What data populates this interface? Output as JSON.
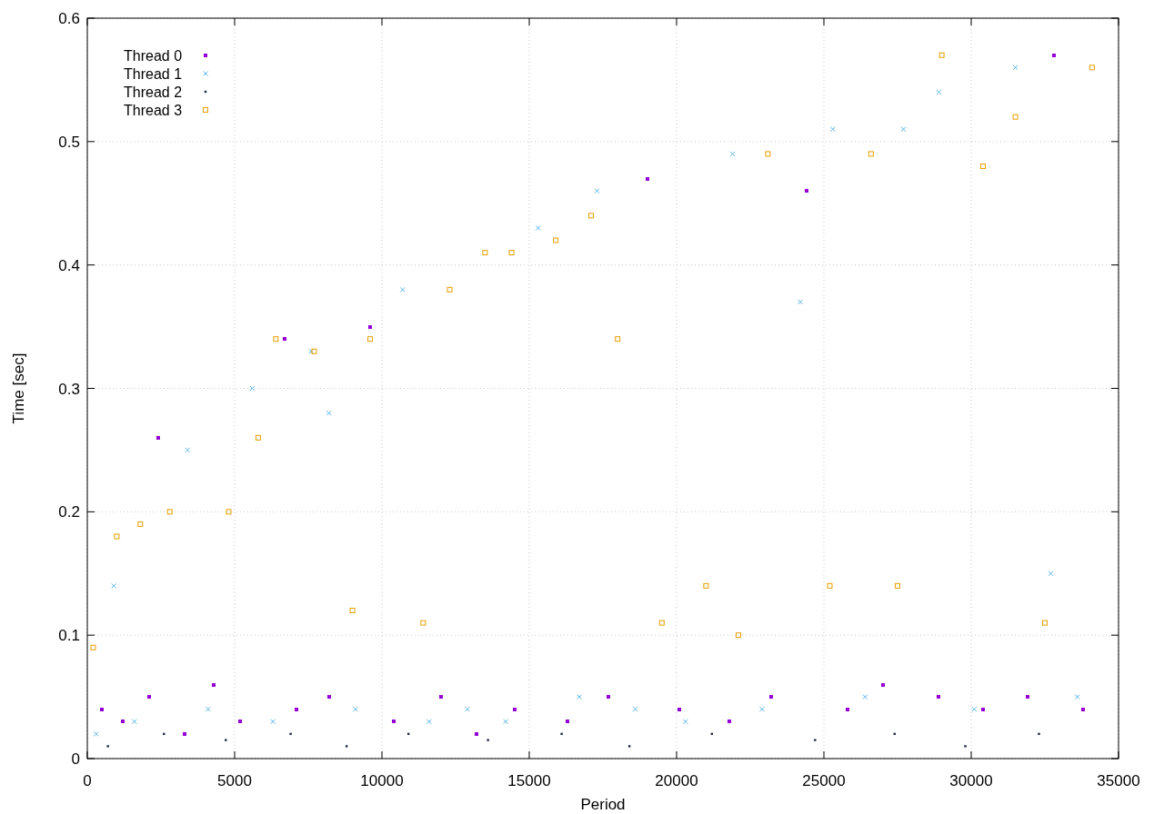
{
  "chart_data": {
    "type": "scatter",
    "grid": true,
    "legend": "top-left",
    "xlabel": "Period",
    "ylabel": "Time [sec]",
    "xlim": [
      0,
      35000
    ],
    "ylim": [
      0,
      0.6
    ],
    "xticks": [
      0,
      5000,
      10000,
      15000,
      20000,
      25000,
      30000,
      35000
    ],
    "yticks": [
      0,
      0.1,
      0.2,
      0.3,
      0.4,
      0.5,
      0.6
    ],
    "series": [
      {
        "name": "Thread 0",
        "color": "#9400d3",
        "x": [
          500,
          1200,
          2100,
          2400,
          3300,
          4300,
          5200,
          6700,
          7100,
          8200,
          9600,
          10400,
          12000,
          13200,
          14500,
          16300,
          17700,
          19000,
          20100,
          21800,
          23200,
          24400,
          25800,
          27000,
          28900,
          30400,
          31900,
          32800,
          33800
        ],
        "values": [
          0.04,
          0.03,
          0.05,
          0.26,
          0.02,
          0.06,
          0.03,
          0.34,
          0.04,
          0.05,
          0.35,
          0.03,
          0.05,
          0.02,
          0.04,
          0.03,
          0.05,
          0.47,
          0.04,
          0.03,
          0.05,
          0.46,
          0.04,
          0.06,
          0.05,
          0.04,
          0.05,
          0.57,
          0.04
        ]
      },
      {
        "name": "Thread 1",
        "color": "#56b4e9",
        "x": [
          300,
          900,
          1600,
          3400,
          4100,
          5600,
          6300,
          7600,
          8200,
          9100,
          10700,
          11600,
          12900,
          14200,
          15300,
          16700,
          17300,
          18600,
          20300,
          21900,
          22900,
          24200,
          25300,
          26400,
          27700,
          28900,
          30100,
          31500,
          32700,
          33600
        ],
        "values": [
          0.02,
          0.14,
          0.03,
          0.25,
          0.04,
          0.3,
          0.03,
          0.33,
          0.28,
          0.04,
          0.38,
          0.03,
          0.04,
          0.03,
          0.43,
          0.05,
          0.46,
          0.04,
          0.03,
          0.49,
          0.04,
          0.37,
          0.51,
          0.05,
          0.51,
          0.54,
          0.04,
          0.56,
          0.15,
          0.05
        ]
      },
      {
        "name": "Thread 2",
        "color": "#1f2a44",
        "x": [
          700,
          2600,
          4700,
          6900,
          8800,
          10900,
          13600,
          16100,
          18400,
          21200,
          24700,
          27400,
          29800,
          32300
        ],
        "values": [
          0.01,
          0.02,
          0.015,
          0.02,
          0.01,
          0.02,
          0.015,
          0.02,
          0.01,
          0.02,
          0.015,
          0.02,
          0.01,
          0.02
        ]
      },
      {
        "name": "Thread 3",
        "color": "#e69f00",
        "x": [
          200,
          1000,
          1800,
          2800,
          4800,
          5800,
          6400,
          7700,
          9000,
          9600,
          11400,
          12300,
          13500,
          14400,
          15900,
          17100,
          18000,
          19500,
          21000,
          22100,
          23100,
          25200,
          26600,
          27500,
          29000,
          30400,
          31500,
          32500,
          34100
        ],
        "values": [
          0.09,
          0.18,
          0.19,
          0.2,
          0.2,
          0.26,
          0.34,
          0.33,
          0.12,
          0.34,
          0.11,
          0.38,
          0.41,
          0.41,
          0.42,
          0.44,
          0.34,
          0.11,
          0.14,
          0.1,
          0.49,
          0.14,
          0.49,
          0.14,
          0.57,
          0.48,
          0.52,
          0.11,
          0.56
        ]
      }
    ]
  }
}
